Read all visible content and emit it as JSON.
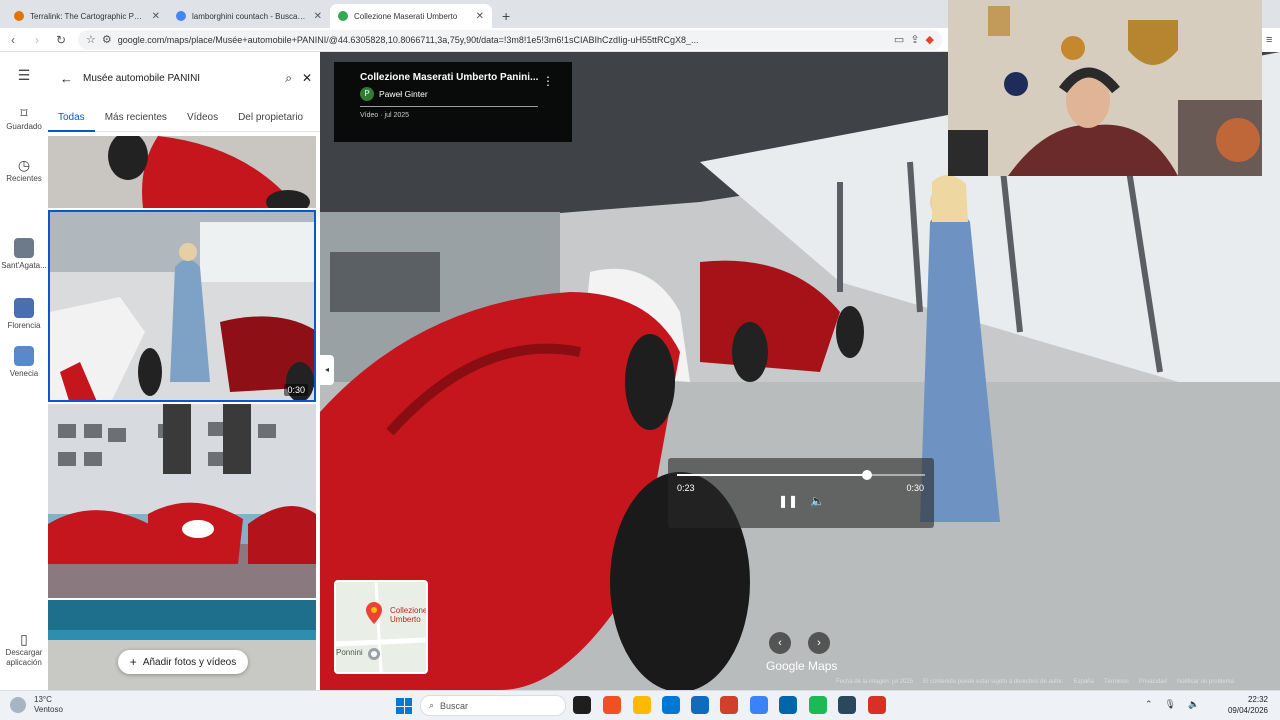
{
  "browser": {
    "tabs": [
      {
        "label": "Terralink: The Cartographic Poster Eng",
        "active": false,
        "favicon_color": "#e37400"
      },
      {
        "label": "lamborghini countach - Buscar con G",
        "active": false,
        "favicon_color": "#4285f4"
      },
      {
        "label": "Collezione Maserati Umberto",
        "active": true,
        "favicon_color": "#34a853"
      }
    ],
    "new_tab": "+",
    "url": "google.com/maps/place/Musée+automobile+PANINI/@44.6305828,10.8066711,3a,75y,90t/data=!3m8!1e5!3m6!1sCIABIhCzdIig-uH55ttRCgX8_..."
  },
  "rail": {
    "items": [
      {
        "label": "Guardado",
        "icon": "bookmark-icon"
      },
      {
        "label": "Recientes",
        "icon": "history-icon"
      },
      {
        "label": "Sant'Agata...",
        "icon": "place-thumb"
      },
      {
        "label": "Florencia",
        "icon": "place-thumb"
      },
      {
        "label": "Venecia",
        "icon": "place-thumb"
      },
      {
        "label": "Descargar aplicación",
        "icon": "phone-icon"
      }
    ],
    "colors": [
      "#6d7a89",
      "#4a6fb0",
      "#5a89c9"
    ]
  },
  "panel": {
    "search_query": "Musée automobile PANINI",
    "tabs": [
      "Todas",
      "Más recientes",
      "Vídeos",
      "Del propietario"
    ],
    "thumb_duration": "0:30",
    "add_button": "Añadir fotos y vídeos"
  },
  "video": {
    "title": "Collezione Maserati Umberto Panini...",
    "author_initial": "P",
    "author": "Paweł Ginter",
    "date": "Vídeo · jul 2025",
    "current_time": "0:23",
    "total_time": "0:30",
    "progress": 0.767,
    "minimap_label": "Collezione Umberto",
    "minimap_label2": "Ponnini",
    "brand": "Google Maps",
    "footer": [
      "Fecha de la imagen: jul 2025",
      "El contenido puede estar sujeto a derechos de autor.",
      "España",
      "Términos",
      "Privacidad",
      "Notificar un problema"
    ]
  },
  "taskbar": {
    "temp": "13°C",
    "condition": "Ventoso",
    "search_placeholder": "Buscar",
    "time": "22:32",
    "date": "09/04/2026",
    "apps": [
      "#1e1e1e",
      "#f25022",
      "#ffb900",
      "#0078d4",
      "#0f6cbd",
      "#d1402a",
      "#3b82f6",
      "#0065a9",
      "#1db954",
      "#2a475e",
      "#d93025"
    ]
  }
}
